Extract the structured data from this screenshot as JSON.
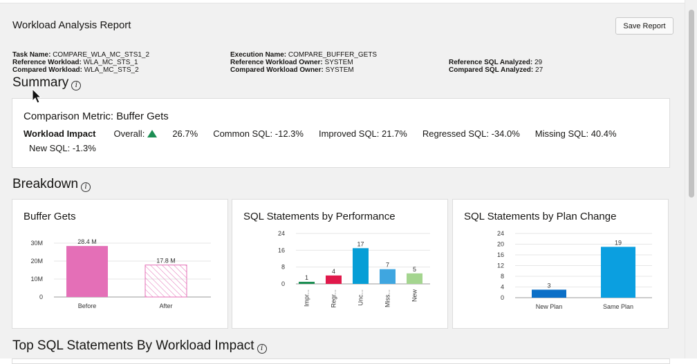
{
  "header": {
    "title": "Workload Analysis Report",
    "save_button": "Save Report"
  },
  "meta": {
    "task_name_label": "Task Name:",
    "task_name": "COMPARE_WLA_MC_STS1_2",
    "reference_workload_label": "Reference Workload:",
    "reference_workload": "WLA_MC_STS_1",
    "compared_workload_label": "Compared Workload:",
    "compared_workload": "WLA_MC_STS_2",
    "execution_name_label": "Execution Name:",
    "execution_name": "COMPARE_BUFFER_GETS",
    "reference_owner_label": "Reference Workload Owner:",
    "reference_owner": "SYSTEM",
    "compared_owner_label": "Compared Workload Owner:",
    "compared_owner": "SYSTEM",
    "reference_sql_label": "Reference SQL Analyzed:",
    "reference_sql": "29",
    "compared_sql_label": "Compared SQL Analyzed:",
    "compared_sql": "27"
  },
  "summary": {
    "title": "Summary",
    "metric_title": "Comparison Metric: Buffer Gets",
    "impact_label": "Workload Impact",
    "overall_label": "Overall:",
    "overall_value": "26.7%",
    "overall_trend": "up",
    "common_sql": "Common SQL: -12.3%",
    "improved_sql": "Improved SQL: 21.7%",
    "regressed_sql": "Regressed SQL: -34.0%",
    "missing_sql": "Missing SQL: 40.4%",
    "new_sql": "New SQL: -1.3%"
  },
  "breakdown": {
    "title": "Breakdown"
  },
  "top_sql": {
    "title": "Top SQL Statements By Workload Impact"
  },
  "colors": {
    "before_bar": "#e46fb7",
    "after_hatch": "#e46fb7",
    "improved": "#1c8e53",
    "regressed": "#e0194b",
    "unchanged": "#069ed6",
    "missing": "#3fa6e0",
    "new": "#a4d58f",
    "plan_new": "#0b6fc7",
    "plan_same": "#0b9fe0",
    "trend_up": "#1c8e53"
  },
  "chart_data": [
    {
      "type": "bar",
      "title": "Buffer Gets",
      "categories": [
        "Before",
        "After"
      ],
      "values": [
        28.4,
        17.8
      ],
      "data_labels": [
        "28.4 M",
        "17.8 M"
      ],
      "y_ticks": [
        "0",
        "10M",
        "20M",
        "30M"
      ],
      "ylim": [
        0,
        35
      ],
      "units": "M",
      "grid": true,
      "legend": "none"
    },
    {
      "type": "bar",
      "title": "SQL Statements by Performance",
      "categories": [
        "Impr...",
        "Regr...",
        "Unc...",
        "Miss...",
        "New"
      ],
      "values": [
        1,
        4,
        17,
        7,
        5
      ],
      "y_ticks": [
        "0",
        "8",
        "16",
        "24"
      ],
      "ylim": [
        0,
        24
      ],
      "grid": true,
      "legend": "none"
    },
    {
      "type": "bar",
      "title": "SQL Statements by Plan Change",
      "categories": [
        "New Plan",
        "Same Plan"
      ],
      "values": [
        3,
        19
      ],
      "y_ticks": [
        "0",
        "4",
        "8",
        "12",
        "16",
        "20",
        "24"
      ],
      "ylim": [
        0,
        24
      ],
      "grid": true,
      "legend": "none"
    }
  ]
}
